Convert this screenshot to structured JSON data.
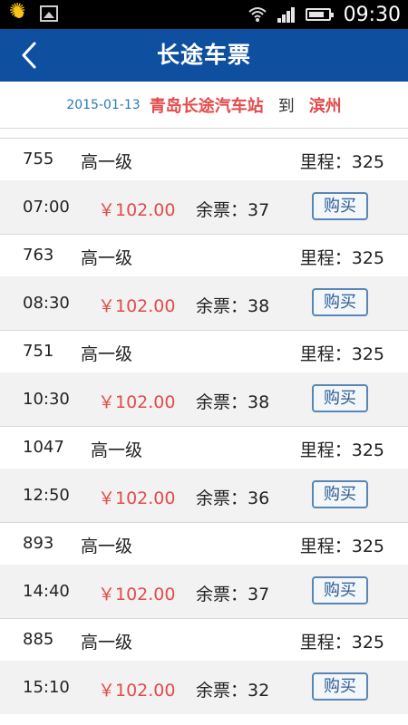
{
  "status_bar": {
    "time": "09:30",
    "icons": [
      "sun-icon",
      "gallery-icon",
      "wifi-icon",
      "signal-icon",
      "battery-icon"
    ]
  },
  "header": {
    "title": "长途车票",
    "back_icon": "chevron-left-icon"
  },
  "route": {
    "date": "2015-01-13",
    "from": "青岛长途汽车站",
    "to_word": "到",
    "destination": "滨州"
  },
  "trips": [
    {
      "no": "755",
      "class": "高一级",
      "distance": "里程：325",
      "time": "07:00",
      "price": "￥102.00",
      "seats": "余票：37",
      "buy_label": "购买"
    },
    {
      "no": "763",
      "class": "高一级",
      "distance": "里程：325",
      "time": "08:30",
      "price": "￥102.00",
      "seats": "余票：38",
      "buy_label": "购买"
    },
    {
      "no": "751",
      "class": "高一级",
      "distance": "里程：325",
      "time": "10:30",
      "price": "￥102.00",
      "seats": "余票：38",
      "buy_label": "购买"
    },
    {
      "no": "1047",
      "class": "高一级",
      "distance": "里程：325",
      "time": "12:50",
      "price": "￥102.00",
      "seats": "余票：36",
      "buy_label": "购买"
    },
    {
      "no": "893",
      "class": "高一级",
      "distance": "里程：325",
      "time": "14:40",
      "price": "￥102.00",
      "seats": "余票：37",
      "buy_label": "购买"
    },
    {
      "no": "885",
      "class": "高一级",
      "distance": "里程：325",
      "time": "15:10",
      "price": "￥102.00",
      "seats": "余票：32",
      "buy_label": "购买"
    }
  ],
  "colors": {
    "header_bg": "#0f4fa0",
    "accent_red": "#e34b4b",
    "date_blue": "#2a7ab8",
    "row_alt_bg": "#f2f2f2"
  }
}
